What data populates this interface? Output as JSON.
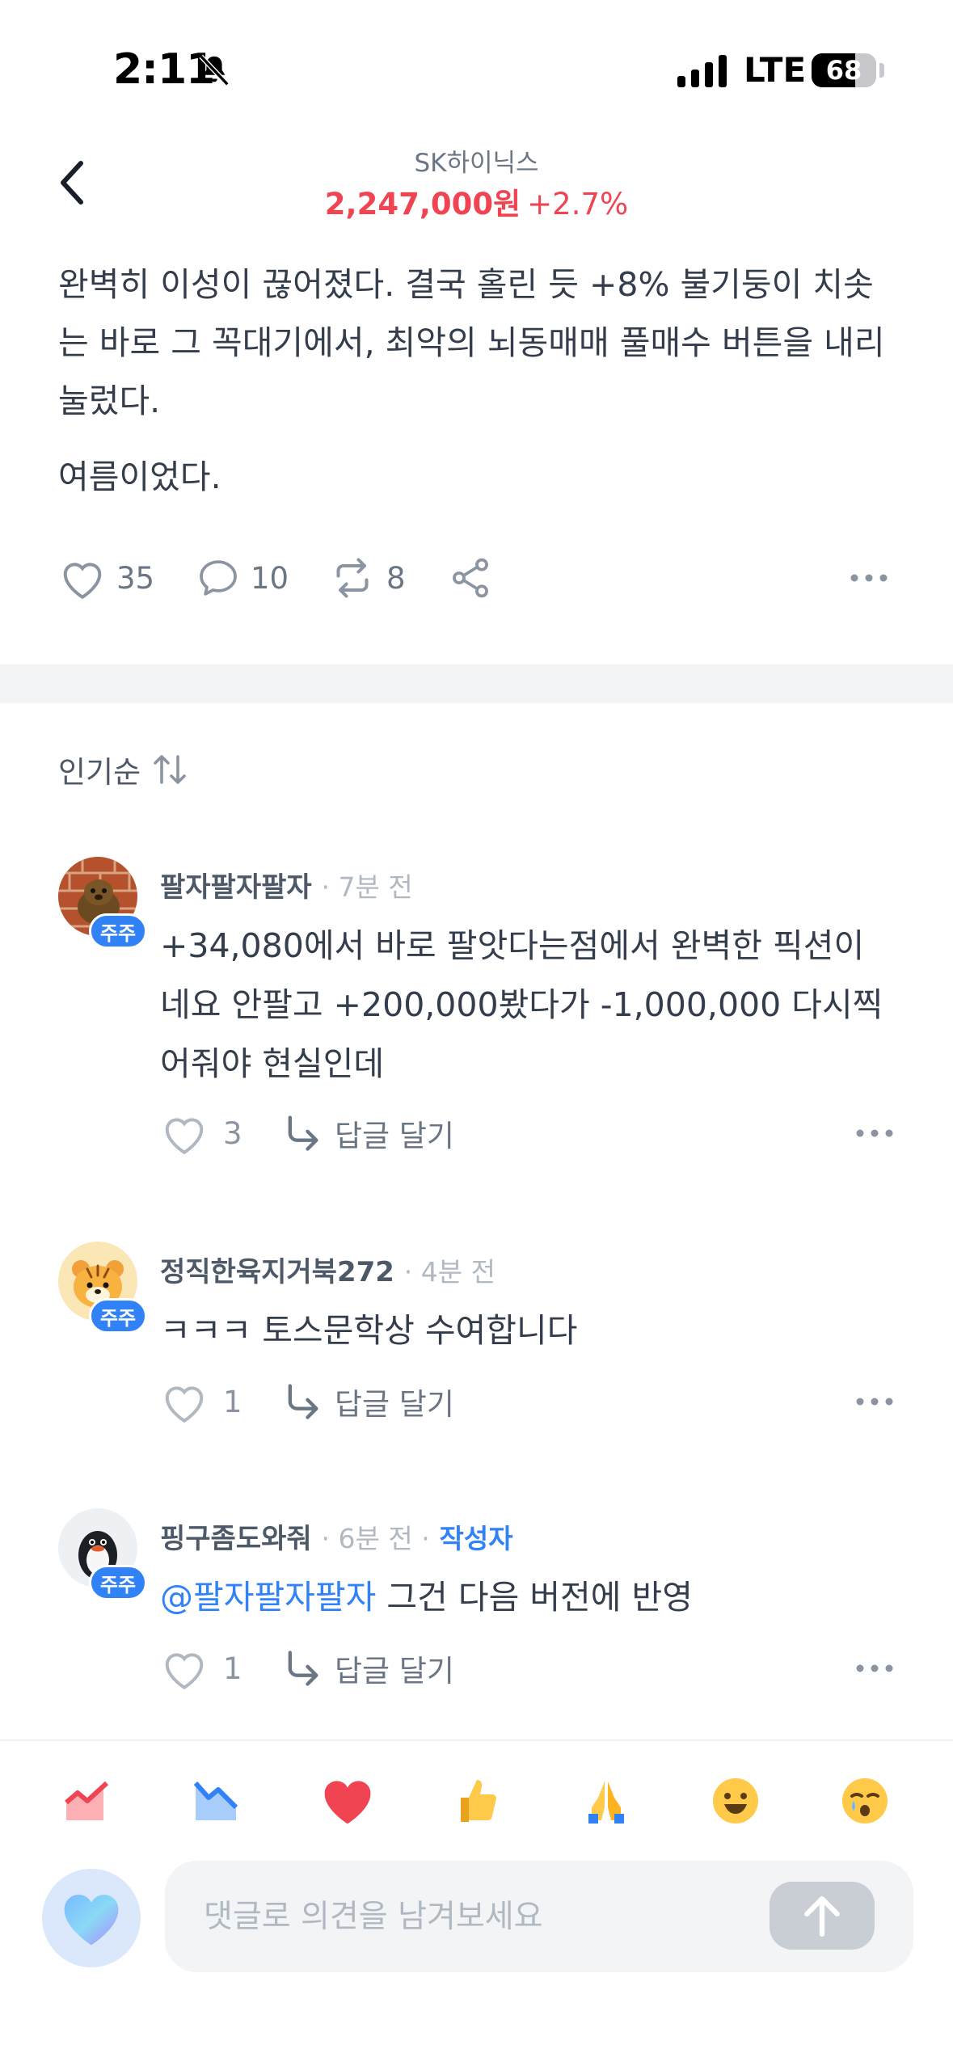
{
  "status_bar": {
    "time": "2:11",
    "network": "LTE",
    "battery": "68",
    "battery_level": 0.68
  },
  "header": {
    "stock_name": "SK하이닉스",
    "price": "2,247,000원",
    "change": "+2.7%",
    "price_color": "#f04452"
  },
  "post": {
    "paragraph_1": "완벽히 이성이 끊어졌다. 결국 홀린 듯 +8% 불기둥이 치솟는 바로 그 꼭대기에서, 최악의 뇌동매매 풀매수 버튼을 내리눌렀다.",
    "paragraph_2": "여름이었다.",
    "likes": "35",
    "comments": "10",
    "reposts": "8"
  },
  "sort": {
    "label": "인기순"
  },
  "comments": [
    {
      "name": "팔자팔자팔자",
      "time": "· 7분 전",
      "badge": "주주",
      "body": "+34,080에서 바로 팔앗다는점에서 완벽한 픽션이네요 안팔고 +200,000봤다가 -1,000,000 다시찍어줘야 현실인데",
      "likes": "3",
      "reply_label": "답글 달기"
    },
    {
      "name": "정직한육지거북272",
      "time": "· 4분 전",
      "badge": "주주",
      "body": "ㅋㅋㅋ 토스문학상 수여합니다",
      "likes": "1",
      "reply_label": "답글 달기"
    },
    {
      "name": "핑구좀도와줘",
      "time": "· 6분 전 ·",
      "author_tag": "작성자",
      "badge": "주주",
      "mention": "@팔자팔자팔자",
      "body": "그건 다음 버전에 반영",
      "likes": "1",
      "reply_label": "답글 달기"
    }
  ],
  "reactions": [
    "chart-up-icon",
    "chart-down-icon",
    "heart-icon",
    "thumbs-up-icon",
    "pray-icon",
    "smile-icon",
    "crying-icon"
  ],
  "input": {
    "placeholder": "댓글로 의견을 남겨보세요"
  },
  "colors": {
    "accent_blue": "#3182f6",
    "red": "#f04452",
    "gray_text": "#6b7684"
  }
}
